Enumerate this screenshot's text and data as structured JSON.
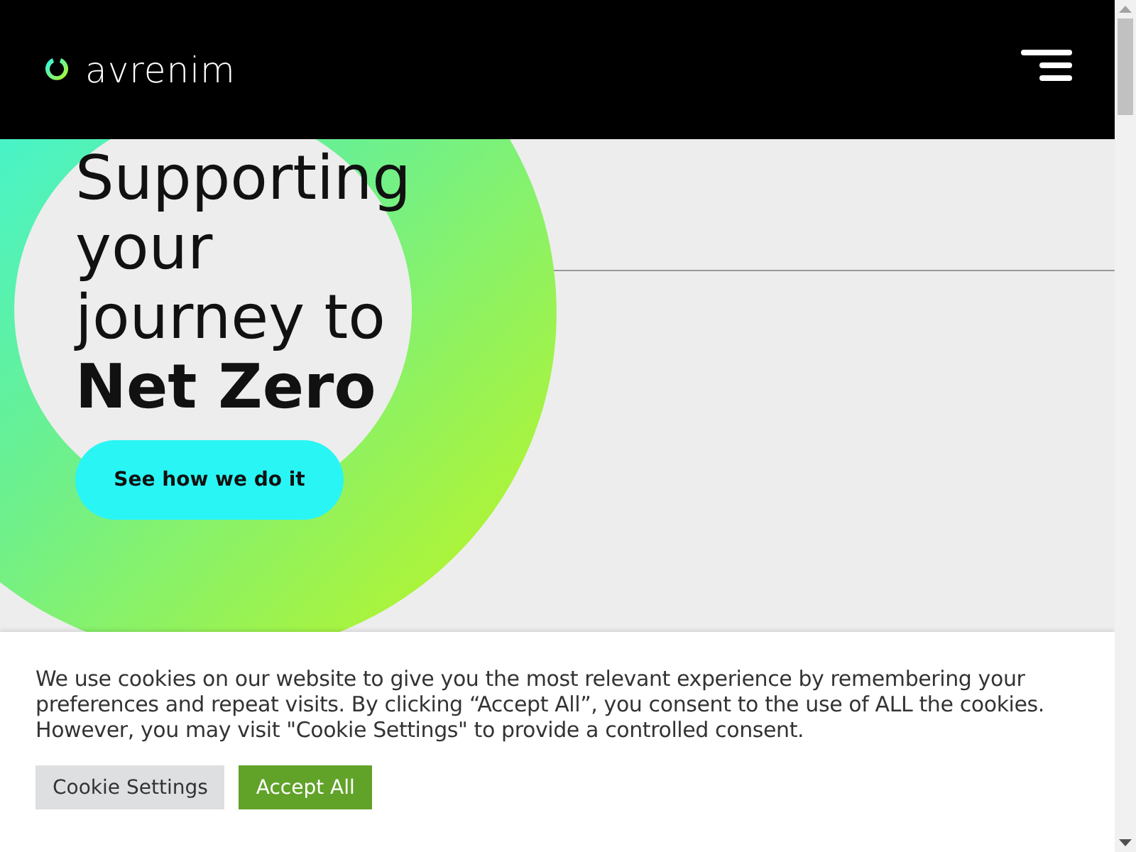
{
  "header": {
    "logo_text": "avrenim"
  },
  "hero": {
    "heading": "Supporting your journey to **Net Zero**",
    "cta": "See how we do it",
    "kind": "picture"
  },
  "cookie_banner": {
    "message": "We use cookies on our website to give you the most relevant experience by remembering your preferences and repeat visits. By clicking “Accept All”, you consent to the use of ALL the cookies. However, you may visit \"Cookie Settings\" to provide a controlled consent.",
    "buttons": [
      {
        "label": "Cookie Settings",
        "kind": "secondary"
      },
      {
        "label": "Accept All",
        "kind": "primary"
      }
    ]
  }
}
